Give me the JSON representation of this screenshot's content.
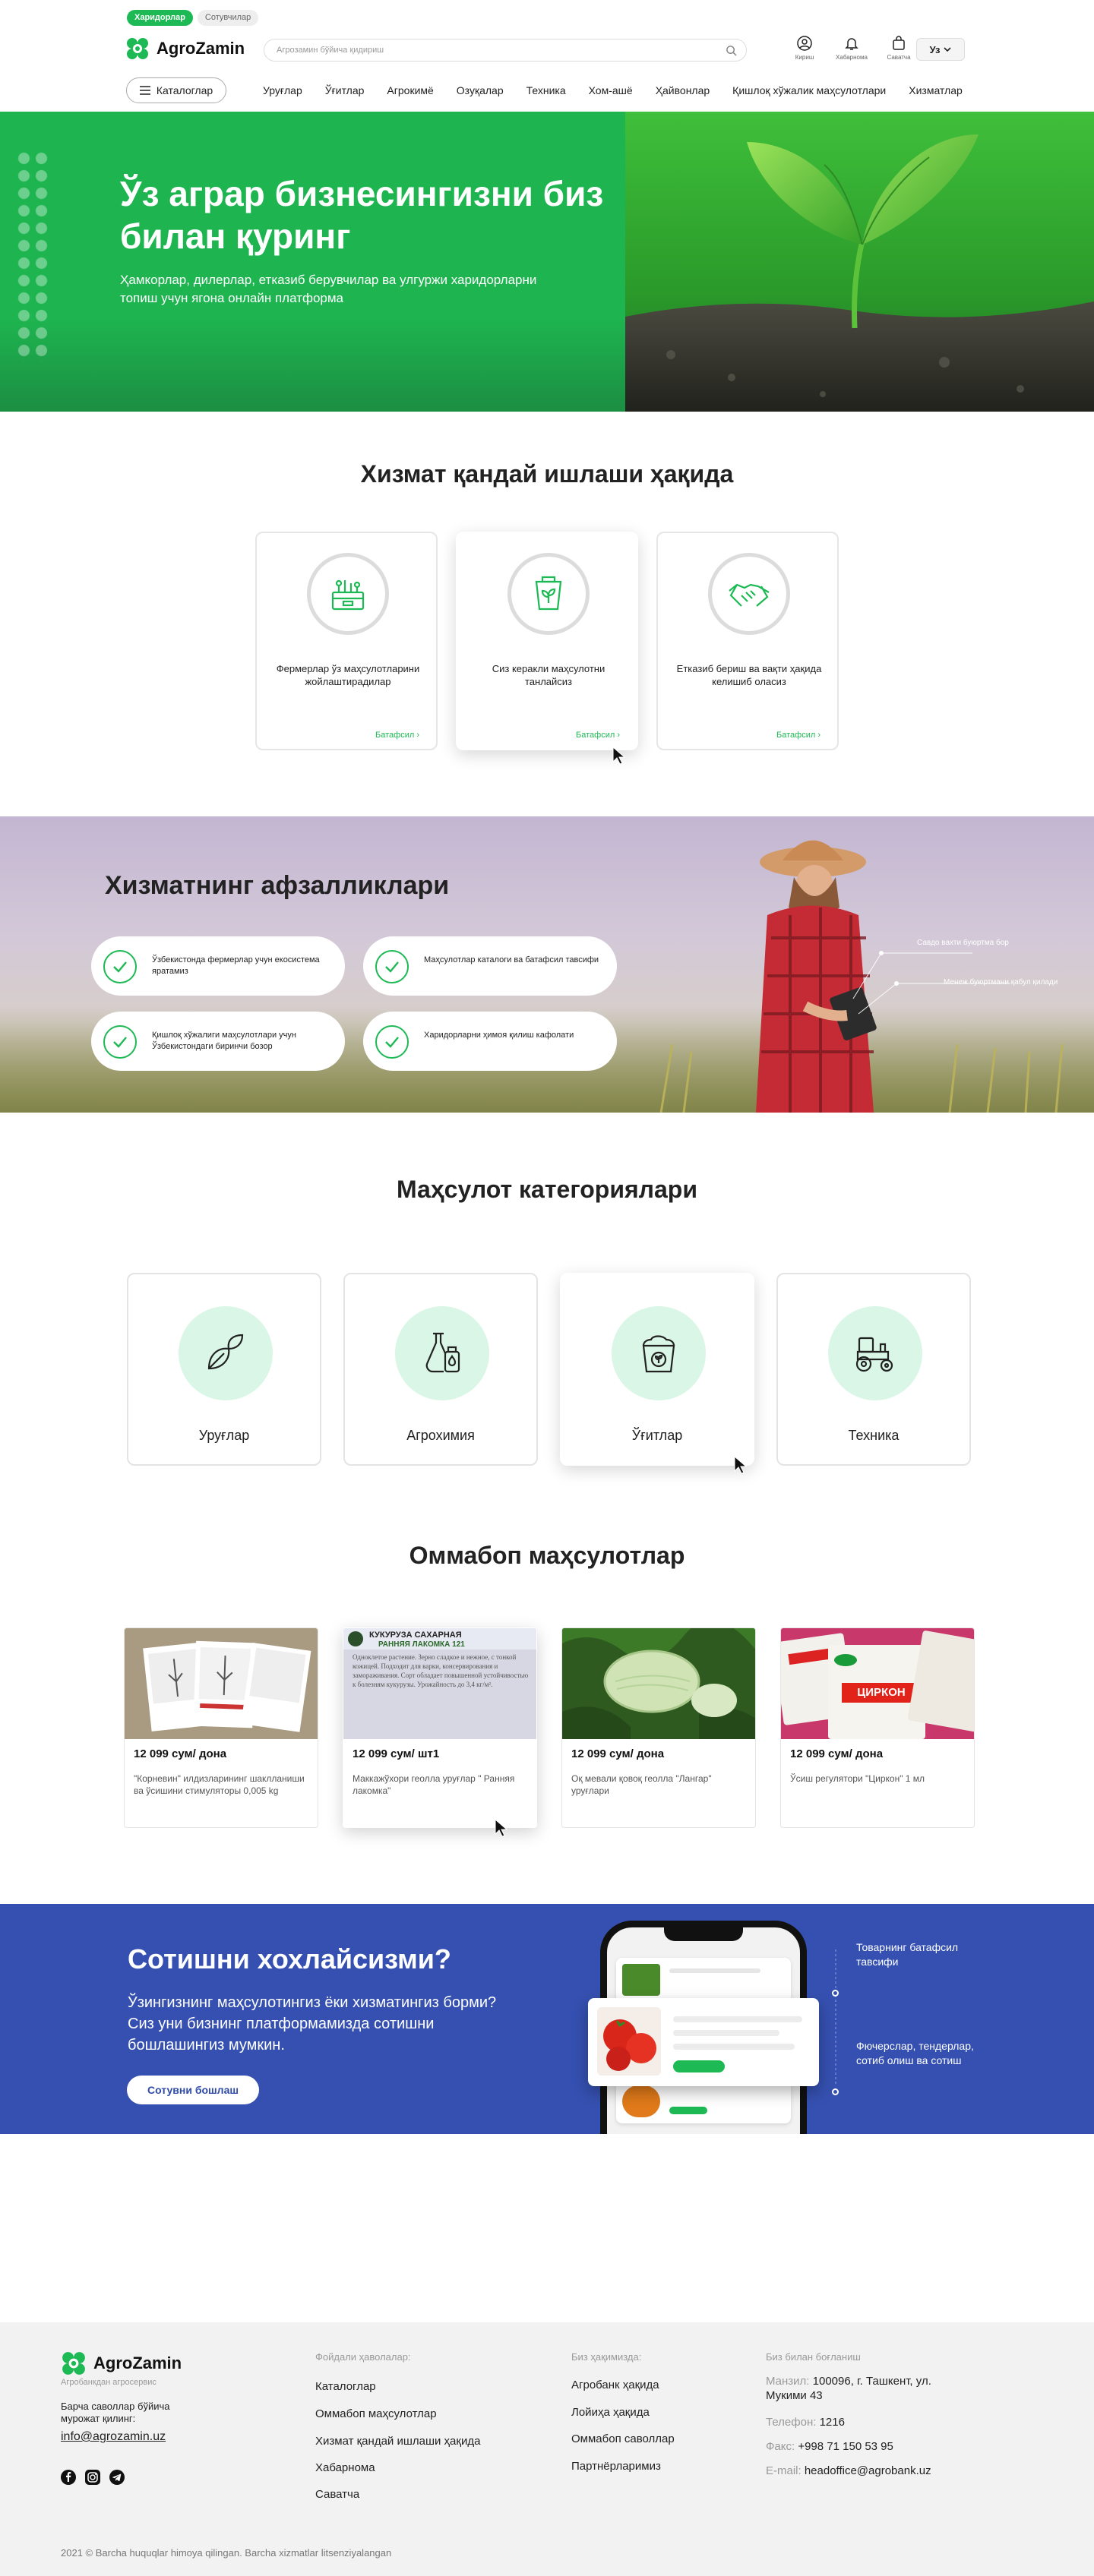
{
  "header": {
    "role_tabs": [
      "Харидорлар",
      "Сотувчилар"
    ],
    "logo_text": "AgroZamin",
    "search_placeholder": "Агрозамин бўйича қидириш",
    "icons": [
      {
        "label": "Кириш",
        "icon": "user-icon"
      },
      {
        "label": "Хабарнома",
        "icon": "bell-icon"
      },
      {
        "label": "Саватча",
        "icon": "bag-icon"
      }
    ],
    "lang": "Уз",
    "catalog_label": "Каталоглар",
    "nav": [
      "Уруғлар",
      "Ўғитлар",
      "Агрокимё",
      "Озуқалар",
      "Техника",
      "Хом-ашё",
      "Ҳайвонлар",
      "Қишлоқ хўжалик маҳсулотлари",
      "Хизматлар"
    ]
  },
  "hero": {
    "title": "Ўз аграр бизнесингизни биз билан қуринг",
    "subtitle": "Ҳамкорлар, дилерлар, етказиб берувчилар ва улгуржи харидорларни топиш учун ягона онлайн платформа"
  },
  "how": {
    "title": "Хизмат қандай ишлаши ҳақида",
    "more_label": "Батафсил",
    "cards": [
      {
        "text": "Фермерлар ўз маҳсулотларини жойлаштирадилар",
        "icon": "crate-icon"
      },
      {
        "text": "Сиз керакли маҳсулотни танлайсиз",
        "icon": "seed-packet-icon"
      },
      {
        "text": "Етказиб бериш ва вақти ҳақида келишиб оласиз",
        "icon": "handshake-icon"
      }
    ]
  },
  "advantages": {
    "title": "Хизматнинг афзалликлари",
    "items": [
      "Ўзбекистонда фермерлар учун екосистема яратамиз",
      "Маҳсулотлар каталоги ва батафсил тавсифи",
      "Қишлоқ хўжалиги маҳсулотлари учун Ўзбекистондаги биринчи бозор",
      "Харидорларни ҳимоя қилиш кафолати"
    ],
    "callouts": [
      "Савдо вахти буюртма бор",
      "Менеж буюртмани қабул қилади"
    ]
  },
  "categories": {
    "title": "Маҳсулот категориялари",
    "items": [
      {
        "label": "Уруғлар",
        "icon": "seed-icon"
      },
      {
        "label": "Агрохимия",
        "icon": "flask-icon"
      },
      {
        "label": "Ўғитлар",
        "icon": "fertilizer-icon"
      },
      {
        "label": "Техника",
        "icon": "tractor-icon"
      }
    ]
  },
  "products": {
    "title": "Оммабоп маҳсулотлар",
    "items": [
      {
        "price": "12 099 сум/ дона",
        "desc": "\"Корневин\" илдизларининг шаклланиши ва ўсишини стимуляторы 0,005 kg"
      },
      {
        "price": "12 099 сум/ шт1",
        "desc": "Маккажўхори геолла уруғлар \" Ранняя лакомка\"",
        "img_title": "КУКУРУЗА САХАРНАЯ",
        "img_subtitle": "РАННЯЯ ЛАКОМКА 121",
        "img_text": "Одноклетое растение. Зерно сладкое и нежное, с тонкой кожицей. Подходит для варки, консервирования и замораживания. Сорт обладает повышенной устойчивостью к болезням кукурузы. Урожайность до 3,4 кг/м²."
      },
      {
        "price": "12 099 сум/ дона",
        "desc": "Оқ мевали қовоқ геолла \"Лангар\" уруғлари"
      },
      {
        "price": "12 099 сум/ дона",
        "desc": "Ўсиш регулятори \"Циркон\" 1 мл",
        "img_label": "ЦИРКОН"
      }
    ]
  },
  "sell": {
    "title": "Сотишни хохлайсизми?",
    "text": "Ўзингизнинг маҳсулотингиз ёки хизматингиз борми? Сиз уни бизнинг платформамизда сотишни бошлашингиз мумкин.",
    "button": "Сотувни бошлаш",
    "notes": [
      "Товарнинг батафсил тавсифи",
      "Фючерслар, тендерлар, сотиб олиш ва сотиш"
    ]
  },
  "footer": {
    "logo_text": "AgroZamin",
    "sub": "Агробанкдан агросервис",
    "ask": "Барча саволлар бўйича мурожат қилинг:",
    "email": "info@agrozamin.uz",
    "useful_title": "Фойдали ҳаволалар:",
    "useful": [
      "Каталоглар",
      "Оммабоп маҳсулотлар",
      "Хизмат қандай ишлаши ҳақида",
      "Хабарнома",
      "Саватча"
    ],
    "about_title": "Биз ҳақимизда:",
    "about": [
      "Агробанк ҳақида",
      "Лойиҳа ҳақида",
      "Оммабоп саволлар",
      "Партнёрларимиз"
    ],
    "contact_title": "Биз билан боғланиш",
    "address_label": "Манзил:",
    "address": "100096, г. Ташкент, ул. Мукими 43",
    "phone_label": "Телефон:",
    "phone": "1216",
    "fax_label": "Факс:",
    "fax": "+998 71 150 53 95",
    "email_label": "E-mail:",
    "email2": "headoffice@agrobank.uz",
    "copyright": "2021 © Barcha huquqlar himoya qilingan. Barcha xizmatlar litsenziyalangan"
  },
  "colors": {
    "accent": "#1db954",
    "banner": "#3550b0"
  }
}
